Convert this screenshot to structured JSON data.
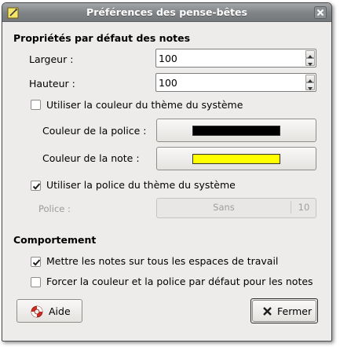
{
  "window": {
    "title": "Préférences des pense-bêtes"
  },
  "defaults_section": {
    "title": "Propriétés par défaut des notes",
    "width_label": "Largeur :",
    "width_value": "100",
    "height_label": "Hauteur :",
    "height_value": "100",
    "use_system_color_label": "Utiliser la couleur du thème du système",
    "use_system_color_checked": false,
    "font_color_label": "Couleur de la police :",
    "font_color": "#000000",
    "note_color_label": "Couleur de la note :",
    "note_color": "#ffff00",
    "use_system_font_label": "Utiliser la police du thème du système",
    "use_system_font_checked": true,
    "font_label": "Police :",
    "font_name": "Sans",
    "font_size": "10"
  },
  "behavior_section": {
    "title": "Comportement",
    "all_workspaces_label": "Mettre les notes sur tous les espaces de travail",
    "all_workspaces_checked": true,
    "force_defaults_label": "Forcer la couleur et la police par défaut pour les notes",
    "force_defaults_checked": false
  },
  "buttons": {
    "help_label": "Aide",
    "close_label": "Fermer"
  },
  "icons": {
    "app": "note-icon",
    "close": "close-icon",
    "help": "lifebuoy-icon",
    "fermer": "x-icon"
  }
}
